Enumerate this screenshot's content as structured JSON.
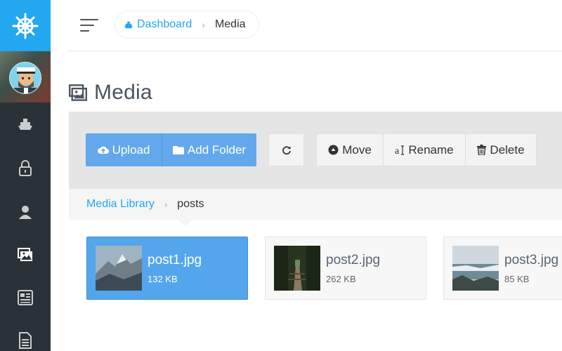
{
  "header": {
    "breadcrumb": {
      "home_label": "Dashboard",
      "separator": "›",
      "current": "Media"
    }
  },
  "page": {
    "title": "Media"
  },
  "toolbar": {
    "upload_label": "Upload",
    "add_folder_label": "Add Folder",
    "move_label": "Move",
    "rename_label": "Rename",
    "delete_label": "Delete"
  },
  "library_breadcrumb": {
    "root": "Media Library",
    "separator": "›",
    "current": "posts"
  },
  "files": [
    {
      "name": "post1.jpg",
      "size": "132 KB",
      "selected": true
    },
    {
      "name": "post2.jpg",
      "size": "262 KB",
      "selected": false
    },
    {
      "name": "post3.jpg",
      "size": "85 KB",
      "selected": false
    }
  ],
  "sidebar": {
    "items": [
      {
        "icon": "ship-icon"
      },
      {
        "icon": "lock-icon"
      },
      {
        "icon": "user-icon"
      },
      {
        "icon": "images-icon",
        "active": true
      },
      {
        "icon": "newspaper-icon"
      },
      {
        "icon": "document-icon"
      }
    ]
  },
  "colors": {
    "accent": "#22a7f0",
    "sidebar": "#2b3237",
    "button_primary": "#62a8ea",
    "selected_file": "#54a6ec"
  }
}
